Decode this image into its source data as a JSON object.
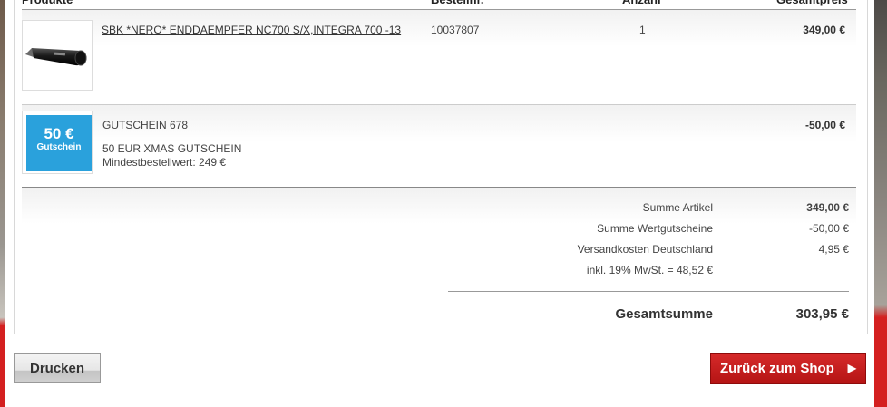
{
  "table": {
    "headers": {
      "products": "Produkte",
      "order_no": "Bestellnr.",
      "quantity": "Anzahl",
      "total_price": "Gesamtpreis"
    },
    "items": [
      {
        "name": "SBK *NERO* ENDDAEMPFER NC700 S/X,INTEGRA 700 -13",
        "order_no": "10037807",
        "quantity": "1",
        "price": "349,00 €"
      }
    ],
    "voucher": {
      "badge_amount": "50 €",
      "badge_label": "Gutschein",
      "title": "GUTSCHEIN 678",
      "description": "50 EUR XMAS GUTSCHEIN",
      "min_order": "Mindestbestellwert: 249 €",
      "price": "-50,00 €"
    }
  },
  "summary": {
    "items_label": "Summe Artikel",
    "items_value": "349,00 €",
    "vouchers_label": "Summe Wertgutscheine",
    "vouchers_value": "-50,00 €",
    "shipping_label": "Versandkosten Deutschland",
    "shipping_value": "4,95 €",
    "tax_label": "inkl. 19% MwSt. = 48,52 €",
    "total_label": "Gesamtsumme",
    "total_value": "303,95 €"
  },
  "buttons": {
    "print": "Drucken",
    "back_to_shop": "Zurück zum Shop"
  },
  "colors": {
    "voucher_blue": "#2aa1dc",
    "shop_button_red": "#c41e1e"
  },
  "icons": {
    "product_image": "exhaust-muffler-image",
    "shop_arrow": "triangle-right-icon"
  }
}
